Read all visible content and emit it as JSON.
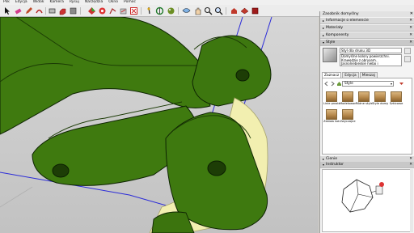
{
  "menu": {
    "items": [
      "Plik",
      "Edycja",
      "Widok",
      "Kamera",
      "Rysuj",
      "Narzędzia",
      "Okno",
      "Pomoc"
    ]
  },
  "toolbar": {
    "tools": [
      "select-tool",
      "eraser-tool",
      "pencil-tool",
      "arc-tool",
      "rectangle-tool",
      "pushpull-tool",
      "move-tool",
      "rotate-tool",
      "scale-tool",
      "offset-tool",
      "tape-tool",
      "text-tool",
      "paint-bucket-tool",
      "orbit-tool",
      "pan-tool",
      "zoom-tool",
      "zoom-extents-tool",
      "warehouse-tool",
      "extension-tool",
      "layout-tool"
    ]
  },
  "panel": {
    "title": "Zasobnik domyślny",
    "trays": [
      {
        "label": "Informacje o elemencie",
        "open": false
      },
      {
        "label": "Materiały",
        "open": false
      },
      {
        "label": "Komponenty",
        "open": false
      },
      {
        "label": "Style",
        "open": true
      }
    ],
    "style": {
      "name": "Styl dla druku 3D",
      "description": "Domyślne kolory powierzchni. Krawędzie z obrysem. Jasnoniebieskie niebo i"
    },
    "tabs": [
      "Zaznacz",
      "Edycja",
      "Mieszaj"
    ],
    "filter": "Style",
    "styles": [
      "Linie proste",
      "Modelowanie",
      "Różne style",
      "Style domyślne",
      "Szkicowe",
      "Zestaw kolorów",
      "Zwyczajne"
    ],
    "bottom_trays": [
      "Cienie",
      "Instruktor"
    ]
  },
  "colors": {
    "model_green": "#3f7a0f",
    "model_dark": "#1e3f05",
    "yellow_part": "#f2efb0",
    "axis_blue": "#2a2ad6"
  }
}
